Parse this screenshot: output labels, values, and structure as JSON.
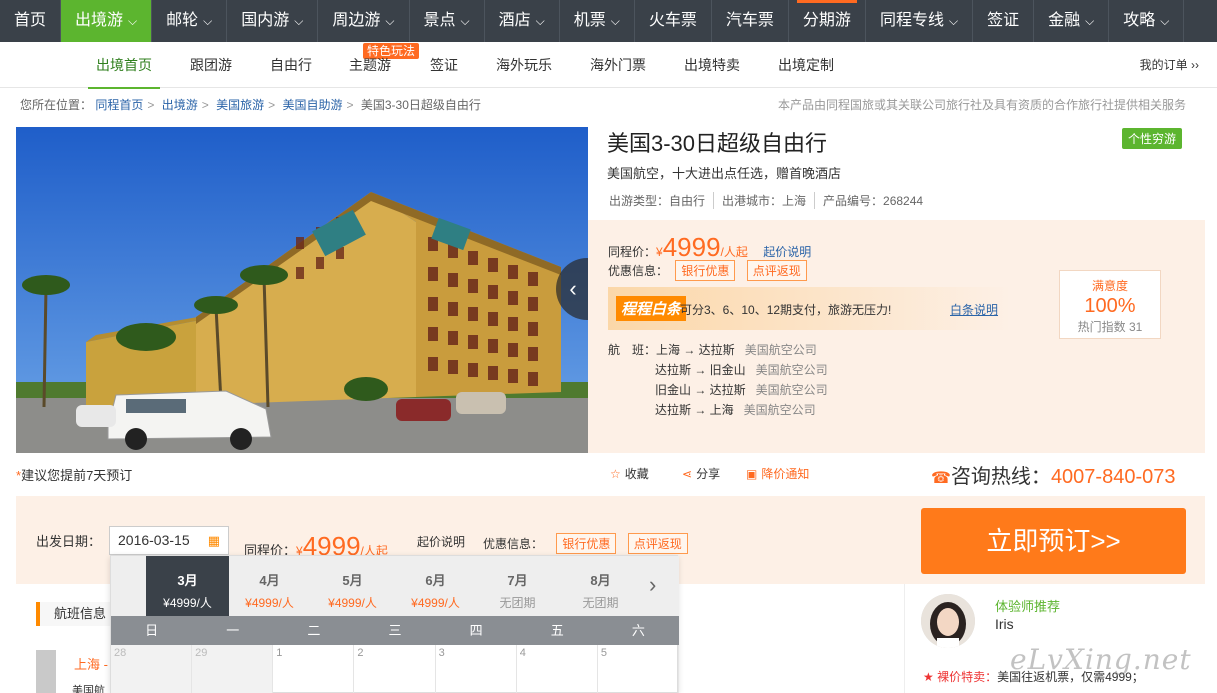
{
  "topnav": [
    {
      "label": "首页",
      "chevron": false
    },
    {
      "label": "出境游",
      "chevron": true,
      "active": true
    },
    {
      "label": "邮轮",
      "chevron": true
    },
    {
      "label": "国内游",
      "chevron": true
    },
    {
      "label": "周边游",
      "chevron": true
    },
    {
      "label": "景点",
      "chevron": true
    },
    {
      "label": "酒店",
      "chevron": true
    },
    {
      "label": "机票",
      "chevron": true
    },
    {
      "label": "火车票",
      "chevron": false
    },
    {
      "label": "汽车票",
      "chevron": false
    },
    {
      "label": "分期游",
      "chevron": false,
      "flag": true
    },
    {
      "label": "同程专线",
      "chevron": true
    },
    {
      "label": "签证",
      "chevron": false
    },
    {
      "label": "金融",
      "chevron": true
    },
    {
      "label": "攻略",
      "chevron": true
    }
  ],
  "subnav": {
    "items": [
      "出境首页",
      "跟团游",
      "自由行",
      "主题游",
      "签证",
      "海外玩乐",
      "海外门票",
      "出境特卖",
      "出境定制"
    ],
    "hot_badge": "特色玩法",
    "my_order": "我的订单 ››"
  },
  "breadcrumb": {
    "prefix": "您所在位置：",
    "links": [
      "同程首页",
      "出境游",
      "美国旅游",
      "美国自助游"
    ],
    "current": "美国3-30日超级自由行"
  },
  "notice": "本产品由同程国旅或其关联公司旅行社及具有资质的合作旅行社提供相关服务",
  "product": {
    "title": "美国3-30日超级自由行",
    "tag": "个性穷游",
    "subtitle": "美国航空，十大进出点任选，赠首晚酒店",
    "meta": [
      "出游类型：自由行",
      "出港城市：上海",
      "产品编号：268244"
    ]
  },
  "price": {
    "label": "同程价：",
    "currency": "¥",
    "value": "4999",
    "unit": "/人起",
    "explain": "起价说明",
    "discount_label": "优惠信息：",
    "discounts": [
      "银行优惠",
      "点评返现"
    ]
  },
  "baitiao": {
    "logo": "程程白条",
    "text": "可分3、6、10、12期支付，旅游无压力!",
    "link": "白条说明"
  },
  "satisfaction": {
    "label": "满意度",
    "value": "100%",
    "hot": "热门指数 31"
  },
  "flights": {
    "label": "航　班：",
    "rows": [
      {
        "route": "上海 → 达拉斯",
        "airline": "美国航空公司"
      },
      {
        "route": "达拉斯 → 旧金山",
        "airline": "美国航空公司"
      },
      {
        "route": "旧金山 → 达拉斯",
        "airline": "美国航空公司"
      },
      {
        "route": "达拉斯 → 上海",
        "airline": "美国航空公司"
      }
    ]
  },
  "advice": {
    "star": "*",
    "text": "建议您提前7天预订"
  },
  "actions": {
    "fav": "收藏",
    "share": "分享",
    "notify": "降价通知"
  },
  "hotline": {
    "label": "咨询热线：",
    "number": "4007-840-073"
  },
  "booking": {
    "date_label": "出发日期：",
    "date_value": "2016-03-15",
    "book_button": "立即预订>>"
  },
  "calendar": {
    "months": [
      {
        "m": "3月",
        "p": "¥4999/人",
        "active": true
      },
      {
        "m": "4月",
        "p": "¥4999/人"
      },
      {
        "m": "5月",
        "p": "¥4999/人"
      },
      {
        "m": "6月",
        "p": "¥4999/人"
      },
      {
        "m": "7月",
        "p": "无团期",
        "na": true
      },
      {
        "m": "8月",
        "p": "无团期",
        "na": true
      }
    ],
    "weekdays": [
      "日",
      "一",
      "二",
      "三",
      "四",
      "五",
      "六"
    ],
    "days": [
      {
        "d": "28",
        "out": true
      },
      {
        "d": "29",
        "out": true
      },
      {
        "d": "1"
      },
      {
        "d": "2"
      },
      {
        "d": "3"
      },
      {
        "d": "4"
      },
      {
        "d": "5"
      }
    ]
  },
  "lower": {
    "flight_heading": "航班信息",
    "city": "上海 -",
    "airline_short": "美国航"
  },
  "recommend": {
    "heading": "体验师推荐",
    "name": "Iris",
    "deal_tag": "★ 裸价特卖：",
    "deal_text": "美国往返机票，仅需4999；"
  },
  "watermark": "eLvXing.net",
  "colors": {
    "accent": "#ff6a21",
    "nav_bg": "#3a4149",
    "active_green": "#5cb52f",
    "link": "#2b64a8"
  }
}
